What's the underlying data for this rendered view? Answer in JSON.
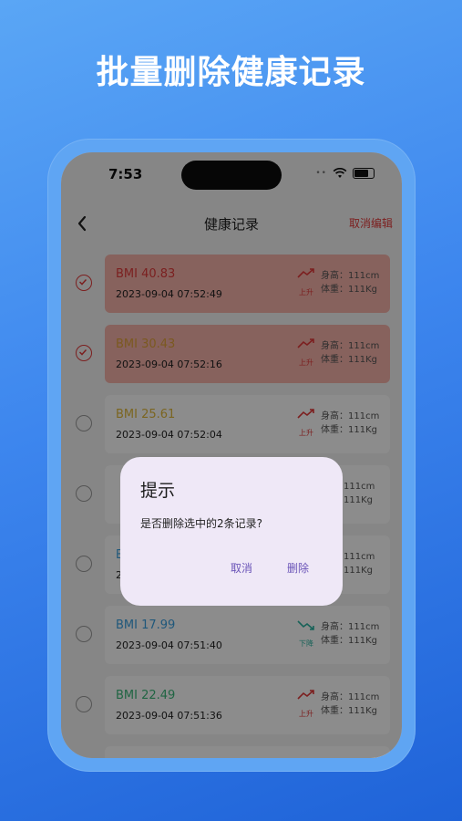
{
  "headline": "批量删除健康记录",
  "status_bar": {
    "time": "7:53",
    "dots": "••"
  },
  "nav": {
    "title": "健康记录",
    "cancel_edit": "取消编辑"
  },
  "records": [
    {
      "bmi": "BMI 40.83",
      "date": "2023-09-04 07:52:49",
      "trend": "上升",
      "height": "身高：111cm",
      "weight": "体重：111Kg",
      "checked": true,
      "color": "#e03b3b"
    },
    {
      "bmi": "BMI 30.43",
      "date": "2023-09-04 07:52:16",
      "trend": "上升",
      "height": "身高：111cm",
      "weight": "体重：111Kg",
      "checked": true,
      "color": "#e0a23b"
    },
    {
      "bmi": "BMI 25.61",
      "date": "2023-09-04 07:52:04",
      "trend": "上升",
      "height": "身高：111cm",
      "weight": "体重：111Kg",
      "checked": false,
      "color": "#e0b83b"
    },
    {
      "bmi": "",
      "date": "",
      "trend": "",
      "height": "111cm",
      "weight": "111Kg",
      "checked": false,
      "color": "#3ba0e0"
    },
    {
      "bmi": "B",
      "date": "2",
      "trend": "",
      "height": "111cm",
      "weight": "111Kg",
      "checked": false,
      "color": "#3ba0e0"
    },
    {
      "bmi": "BMI 17.99",
      "date": "2023-09-04 07:51:40",
      "trend": "下降",
      "height": "身高：111cm",
      "weight": "体重：111Kg",
      "checked": false,
      "color": "#3ba0e0"
    },
    {
      "bmi": "BMI 22.49",
      "date": "2023-09-04 07:51:36",
      "trend": "上升",
      "height": "身高：111cm",
      "weight": "体重：111Kg",
      "checked": false,
      "color": "#3bb87a"
    }
  ],
  "dialog": {
    "title": "提示",
    "message": "是否删除选中的2条记录?",
    "cancel": "取消",
    "delete": "删除"
  },
  "colors": {
    "accent_red": "#e23a3a",
    "dialog_button": "#6b55b8",
    "trend_up": "#e23a3a",
    "trend_down": "#2bb3a0"
  }
}
